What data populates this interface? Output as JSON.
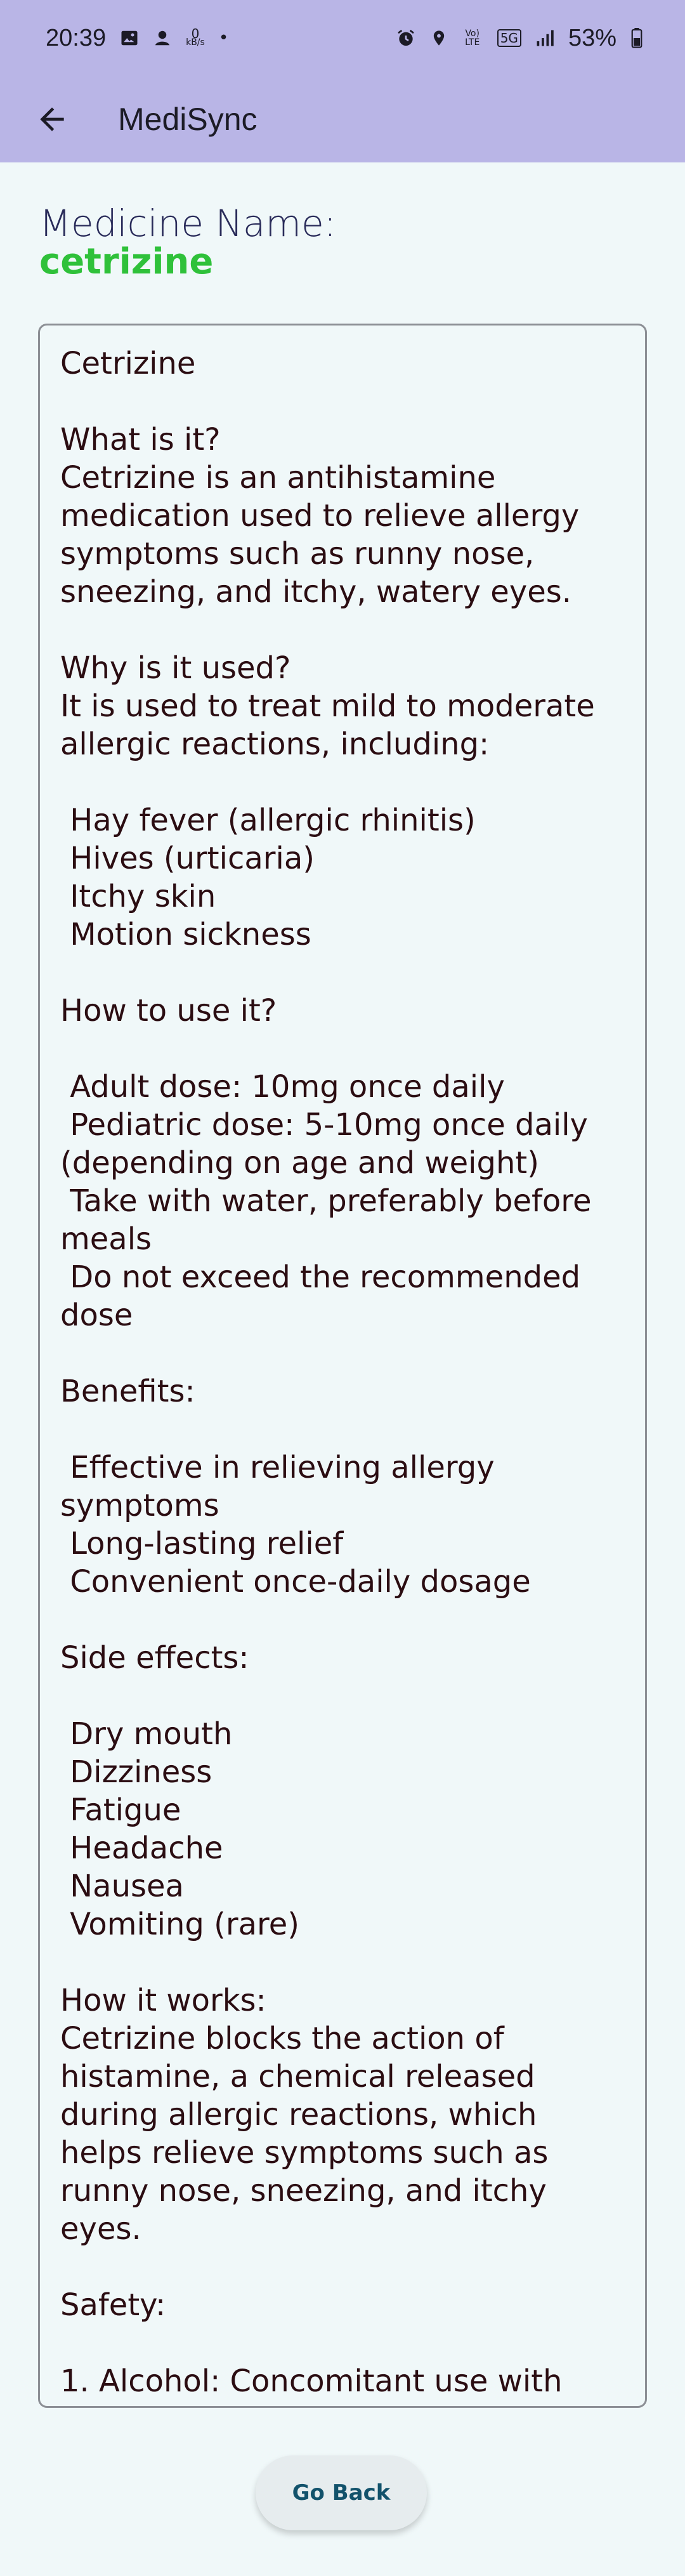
{
  "status_bar": {
    "time": "20:39",
    "left_icons": [
      "image-icon",
      "notification-icon"
    ],
    "data_speed_value": "0",
    "data_speed_unit": "kB/s",
    "dot": "•",
    "right_icons": [
      "alarm-icon",
      "location-icon",
      "volte-icon",
      "5g-icon",
      "signal-icon"
    ],
    "volte_label": "Vo) LTE",
    "fiveg_label": "5G",
    "battery": "53%"
  },
  "app_bar": {
    "title": "MediSync",
    "back_icon": "arrow-left-icon"
  },
  "medicine": {
    "label": "Medicine Name:",
    "name": "cetrizine"
  },
  "info": {
    "text": "Cetrizine\n\nWhat is it?\nCetrizine is an antihistamine medication used to relieve allergy symptoms such as runny nose, sneezing, and itchy, watery eyes.\n\nWhy is it used?\nIt is used to treat mild to moderate allergic reactions, including:\n\n Hay fever (allergic rhinitis)\n Hives (urticaria)\n Itchy skin\n Motion sickness\n\nHow to use it?\n\n Adult dose: 10mg once daily\n Pediatric dose: 5-10mg once daily (depending on age and weight)\n Take with water, preferably before meals\n Do not exceed the recommended dose\n\nBenefits:\n\n Effective in relieving allergy symptoms\n Long-lasting relief\n Convenient once-daily dosage\n\nSide effects:\n\n Dry mouth\n Dizziness\n Fatigue\n Headache\n Nausea\n Vomiting (rare)\n\nHow it works:\nCetrizine blocks the action of histamine, a chemical released during allergic reactions, which helps relieve symptoms such as runny nose, sneezing, and itchy eyes.\n\nSafety:\n\n1. Alcohol: Concomitant use with"
  },
  "buttons": {
    "go_back": "Go Back"
  },
  "colors": {
    "header_bg": "#b9b5e6",
    "page_bg": "#f0f8f9",
    "medicine_name": "#2fc13a",
    "body_text": "#2b0d12",
    "button_text": "#12526b"
  }
}
